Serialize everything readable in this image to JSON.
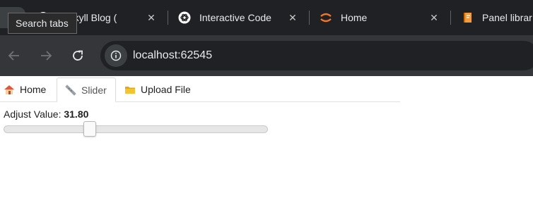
{
  "browser": {
    "tooltip": "Search tabs",
    "tabs": [
      {
        "title": "t Jekyll Blog (",
        "icon": "github-icon"
      },
      {
        "title": "Interactive Code",
        "icon": "openai-icon"
      },
      {
        "title": "Home",
        "icon": "jupyter-icon"
      },
      {
        "title": "Panel librar",
        "icon": "notebook-icon"
      }
    ],
    "tab_close_glyph": "✕",
    "url": "localhost:62545"
  },
  "app": {
    "tabs": [
      {
        "label": "Home",
        "icon": "house-icon",
        "active": false
      },
      {
        "label": "Slider",
        "icon": "ruler-icon",
        "active": true
      },
      {
        "label": "Upload File",
        "icon": "folder-icon",
        "active": false
      }
    ],
    "slider": {
      "label": "Adjust Value:",
      "value_text": "31.80",
      "value_fraction": 0.318
    }
  },
  "colors": {
    "chrome_dark": "#202124",
    "toolbar": "#35363a",
    "jupyter_orange": "#f37726",
    "folder_yellow": "#f4c430"
  }
}
